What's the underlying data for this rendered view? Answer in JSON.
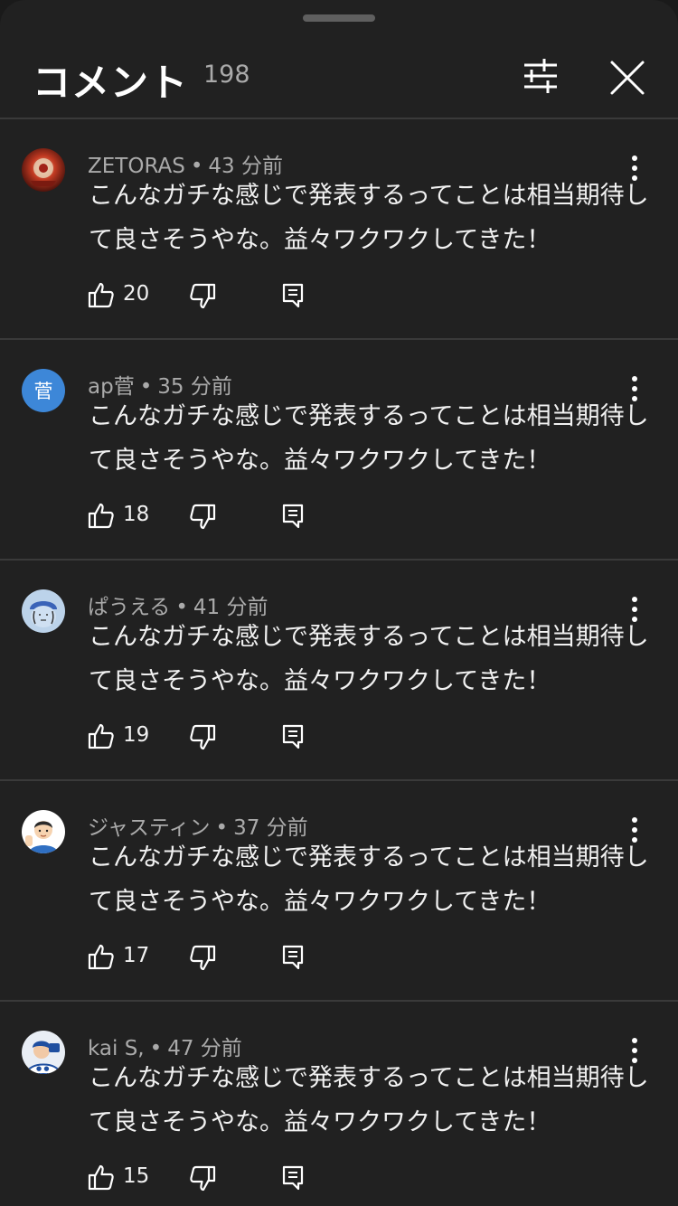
{
  "header": {
    "title": "コメント",
    "count": "198"
  },
  "comments": [
    {
      "author": "ZETORAS",
      "time": "43 分前",
      "text": "こんなガチな感じで発表するってことは相当期待して良さそうやな。益々ワクワクしてきた！",
      "likes": "20",
      "avatar": "avatar-zetoras"
    },
    {
      "author": "ap菅",
      "time": "35 分前",
      "text": "こんなガチな感じで発表するってことは相当期待して良さそうやな。益々ワクワクしてきた！",
      "likes": "18",
      "avatar_letter": "菅"
    },
    {
      "author": "ぱうえる",
      "time": "41 分前",
      "text": "こんなガチな感じで発表するってことは相当期待して良さそうやな。益々ワクワクしてきた！",
      "likes": "19",
      "avatar": "avatar-pauerl"
    },
    {
      "author": "ジャスティン",
      "time": "37 分前",
      "text": "こんなガチな感じで発表するってことは相当期待して良さそうやな。益々ワクワクしてきた！",
      "likes": "17",
      "avatar": "avatar-justin"
    },
    {
      "author": "kai S,",
      "time": "47 分前",
      "text": "こんなガチな感じで発表するってことは相当期待して良さそうやな。益々ワクワクしてきた！",
      "likes": "15",
      "avatar": "avatar-kai"
    }
  ],
  "colors": {
    "background": "#212121",
    "text": "#f1f1f1",
    "secondary_text": "#aaaaaa",
    "divider": "#3a3a3a",
    "avatar_blue": "#3d87d8"
  }
}
